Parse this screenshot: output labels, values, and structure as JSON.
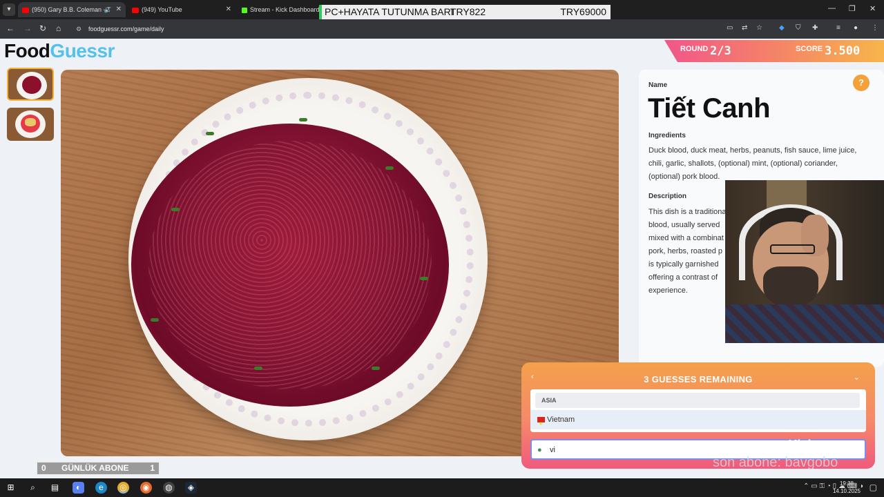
{
  "browser": {
    "tabs": [
      {
        "label": "(950) Gary B.B. Coleman - T",
        "icon": "youtube-icon"
      },
      {
        "label": "(949) YouTube",
        "icon": "youtube-icon"
      },
      {
        "label": "Stream - Kick Dashboard",
        "icon": "kick-icon"
      }
    ],
    "url": "foodguessr.com/game/daily"
  },
  "banner": {
    "text": "PC+HAYATA TUTUNMA BARI",
    "mid": "TRY822",
    "right": "TRY69000"
  },
  "app": {
    "logo_food": "Food",
    "logo_guessr": "Guessr",
    "round_label": "ROUND",
    "round_value": "2/3",
    "score_label": "SCORE",
    "score_value": "3.500"
  },
  "info": {
    "name_label": "Name",
    "name": "Tiết Canh",
    "ingredients_label": "Ingredients",
    "ingredients": "Duck blood, duck meat, herbs, peanuts, fish sauce, lime juice, chili, garlic, shallots, (optional) mint, (optional) coriander, (optional) pork blood.",
    "description_label": "Description",
    "description_lines": [
      "This dish is a traditional",
      "blood, usually served",
      "mixed with a combinat",
      "pork, herbs, roasted p",
      "is typically garnished",
      "offering a contrast of",
      "experience."
    ],
    "help_icon": "question-icon"
  },
  "guess": {
    "title": "3 GUESSES REMAINING",
    "region": "ASIA",
    "country": "Vietnam",
    "input_value": "vi"
  },
  "overlay": {
    "abone_left": "0",
    "abone_label": "GÜNLÜK ABONE",
    "abone_right": "1",
    "sub_text": "son abone: bavgobo"
  },
  "taskbar": {
    "time": "19:38",
    "date": "14.10.2025"
  },
  "colors": {
    "accent_blue": "#54c0ec",
    "panel_gradient_start": "#f4a14a",
    "panel_gradient_end": "#ef5a7d",
    "thumb_border": "#f3b33a"
  }
}
